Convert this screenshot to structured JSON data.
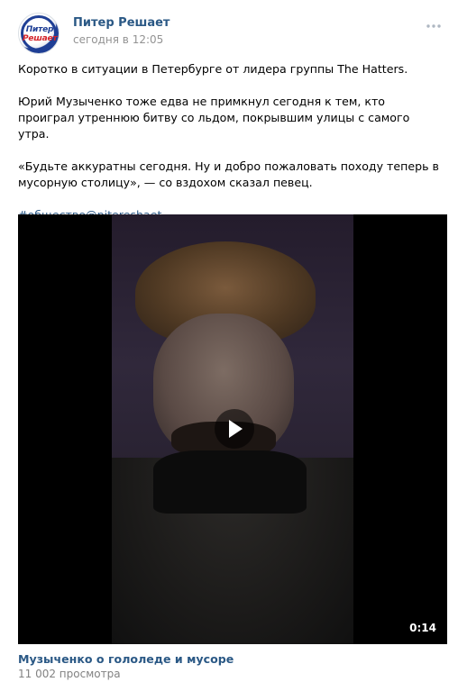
{
  "post": {
    "author": "Питер Решает",
    "time": "сегодня в 12:05",
    "avatar_text_line1": "Питер",
    "avatar_text_line2": "Решает",
    "paragraphs": [
      "Коротко в ситуации в Петербурге от лидера группы The Hatters.",
      "Юрий Музыченко тоже едва не примкнул сегодня к тем, кто проиграл утреннюю битву со льдом, покрывшим улицы с самого утра.",
      "«Будьте аккуратны сегодня. Ну и добро пожаловать походу теперь в мусорную столицу», — со вздохом сказал певец."
    ],
    "hashtag": "#общество@pitereshaet"
  },
  "video": {
    "duration": "0:14",
    "title": "Музыченко о гололеде и мусоре",
    "views": "11 002 просмотра"
  },
  "icons": {
    "more": "more-icon",
    "play": "play-icon"
  },
  "colors": {
    "link": "#2a5885",
    "muted": "#939393",
    "brand_blue": "#1f3f95",
    "brand_red": "#d4232a"
  }
}
